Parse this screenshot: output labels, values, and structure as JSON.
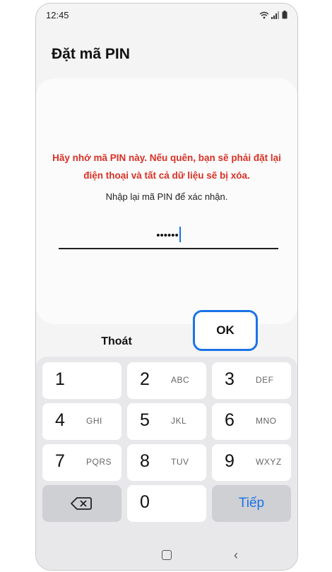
{
  "status_bar": {
    "time": "12:45"
  },
  "title": "Đặt mã PIN",
  "card": {
    "warning_line1": "Hãy nhớ mã PIN này. Nếu quên, bạn sẽ phải đặt lại",
    "warning_line2": "điện thoại và tất cả dữ liệu sẽ bị xóa.",
    "instruction": "Nhập lại mã PIN để xác nhận.",
    "pin_masked": "••••••"
  },
  "actions": {
    "cancel_label": "Thoát",
    "ok_label": "OK"
  },
  "keypad": {
    "keys": [
      {
        "num": "1",
        "letters": ""
      },
      {
        "num": "2",
        "letters": "ABC"
      },
      {
        "num": "3",
        "letters": "DEF"
      },
      {
        "num": "4",
        "letters": "GHI"
      },
      {
        "num": "5",
        "letters": "JKL"
      },
      {
        "num": "6",
        "letters": "MNO"
      },
      {
        "num": "7",
        "letters": "PQRS"
      },
      {
        "num": "8",
        "letters": "TUV"
      },
      {
        "num": "9",
        "letters": "WXYZ"
      }
    ],
    "zero": "0",
    "next_label": "Tiếp",
    "backspace_icon": "backspace-icon"
  },
  "colors": {
    "accent": "#1a73e8",
    "warning": "#d93025"
  }
}
